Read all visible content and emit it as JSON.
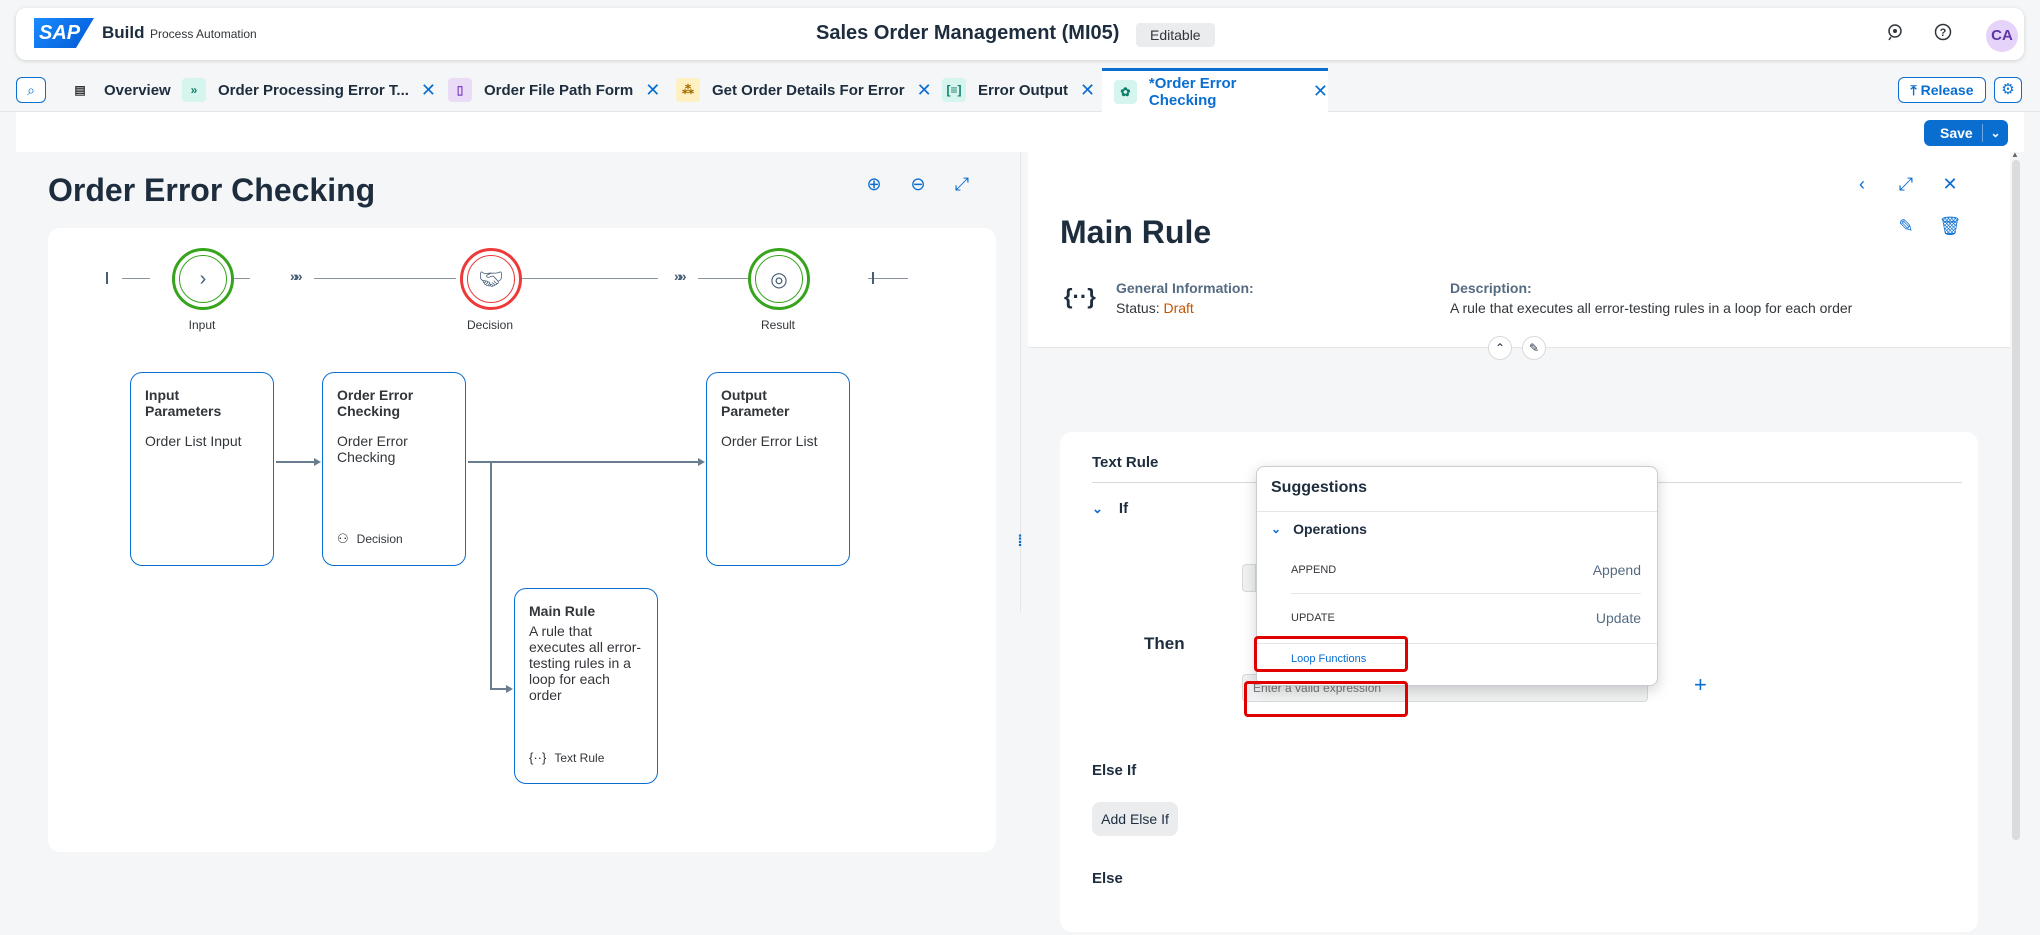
{
  "shell": {
    "logo": "SAP",
    "brand": "Build",
    "brand_sub": "Process Automation",
    "project_title": "Sales Order Management (MI05)",
    "editable_badge": "Editable",
    "avatar_initials": "CA",
    "icons": [
      "feedback-icon",
      "help-icon"
    ]
  },
  "tabs": {
    "items": [
      {
        "label": "Overview",
        "icon": "overview-icon",
        "closable": false
      },
      {
        "label": "Order Processing Error T...",
        "icon": "process-icon",
        "closable": true
      },
      {
        "label": "Order File Path Form",
        "icon": "form-icon",
        "closable": true
      },
      {
        "label": "Get Order Details For Error",
        "icon": "automation-icon",
        "closable": true
      },
      {
        "label": "Error Output",
        "icon": "data-type-icon",
        "closable": true
      },
      {
        "label": "*Order Error Checking",
        "icon": "decision-icon",
        "closable": true,
        "active": true
      }
    ],
    "release_label": "Release"
  },
  "toolbar": {
    "save_label": "Save"
  },
  "left": {
    "title": "Order Error Checking",
    "steps": [
      {
        "label": "Input",
        "color": "#36a41d"
      },
      {
        "label": "Decision",
        "color": "#ee3939"
      },
      {
        "label": "Result",
        "color": "#36a41d"
      }
    ],
    "nodes": {
      "input": {
        "title": "Input Parameters",
        "desc": "Order List Input"
      },
      "decision": {
        "title": "Order Error Checking",
        "desc": "Order Error Checking",
        "foot": "Decision"
      },
      "output": {
        "title": "Output Parameter",
        "desc": "Order Error List"
      },
      "main_rule": {
        "title": "Main Rule",
        "desc": "A rule that executes all error-testing rules in a loop for each order",
        "foot": "Text Rule"
      }
    }
  },
  "right": {
    "title": "Main Rule",
    "general_label": "General Information:",
    "status_prefix": "Status:",
    "status_value": "Draft",
    "description_label": "Description:",
    "description_value": "A rule that executes all error-testing rules in a loop for each order",
    "rule_card": {
      "title": "Text Rule",
      "if_label": "If",
      "then_label": "Then",
      "expression_placeholder": "Enter a valid expression",
      "elseif_label": "Else If",
      "add_elseif_label": "Add Else If",
      "else_label": "Else"
    }
  },
  "suggestions": {
    "title": "Suggestions",
    "group": "Operations",
    "items": [
      {
        "code": "APPEND",
        "label": "Append"
      },
      {
        "code": "UPDATE",
        "label": "Update"
      }
    ],
    "link": "Loop Functions"
  },
  "colors": {
    "accent": "#0a6ed1",
    "highlight": "#e00000",
    "draft": "#c35500"
  }
}
